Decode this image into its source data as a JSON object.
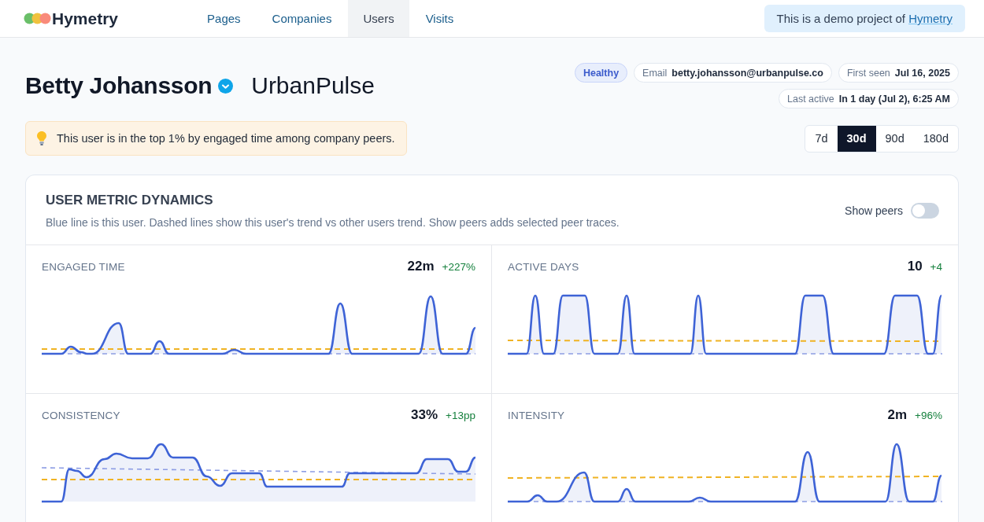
{
  "header": {
    "logo": "Hymetry",
    "nav": [
      {
        "label": "Pages",
        "selected": false
      },
      {
        "label": "Companies",
        "selected": false
      },
      {
        "label": "Users",
        "selected": true
      },
      {
        "label": "Visits",
        "selected": false
      }
    ],
    "demo_notice": {
      "text": "This is a demo project of",
      "link": "Hymetry"
    }
  },
  "profile": {
    "name": "Betty Johansson",
    "verified": true,
    "company": "UrbanPulse",
    "status": "Healthy",
    "chips": [
      {
        "label": "Email",
        "value": "betty.johansson@urbanpulse.co"
      },
      {
        "label": "First seen",
        "value": "Jul 16, 2025"
      },
      {
        "label": "Last active",
        "value": "In 1 day (Jul 2), 6:25 AM"
      }
    ]
  },
  "insight": {
    "text": "This user is in the top 1% by engaged time among company peers."
  },
  "ranges": [
    {
      "label": "7d",
      "selected": false
    },
    {
      "label": "30d",
      "selected": true
    },
    {
      "label": "90d",
      "selected": false
    },
    {
      "label": "180d",
      "selected": false
    }
  ],
  "dynamics": {
    "title": "USER METRIC DYNAMICS",
    "description": "Blue line is this user. Dashed lines show this user's trend vs other users trend. Show peers adds selected peer traces.",
    "show_peers": {
      "label": "Show peers",
      "on": false
    },
    "metrics": [
      {
        "title": "ENGAGED TIME",
        "value": "22m",
        "change": "+227%"
      },
      {
        "title": "ACTIVE DAYS",
        "value": "10",
        "change": "+4"
      },
      {
        "title": "CONSISTENCY",
        "value": "33%",
        "change": "+13pp"
      },
      {
        "title": "INTENSITY",
        "value": "2m",
        "change": "+96%"
      }
    ]
  }
}
